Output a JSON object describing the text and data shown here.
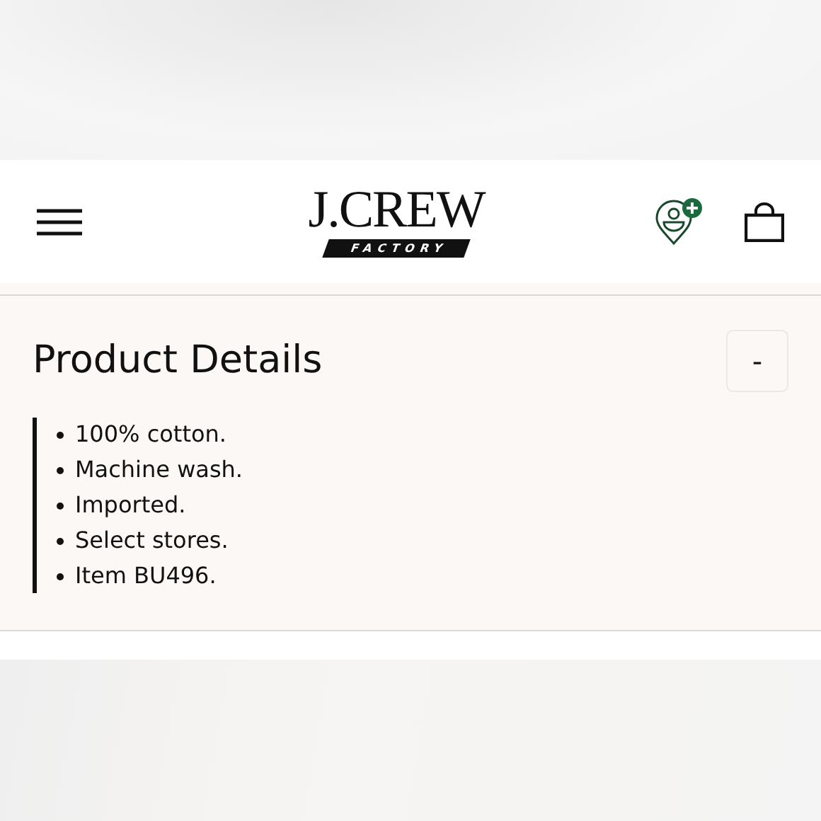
{
  "header": {
    "logo": {
      "wordmark": "J.CREW",
      "tagline": "FACTORY"
    }
  },
  "product_details": {
    "title": "Product Details",
    "toggle": "-",
    "items": [
      "100% cotton.",
      "Machine wash.",
      "Imported.",
      "Select stores.",
      "Item BU496."
    ]
  }
}
